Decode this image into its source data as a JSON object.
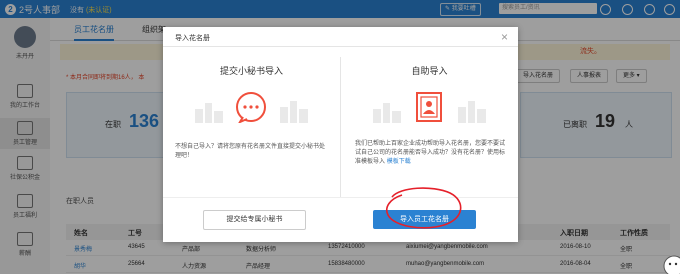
{
  "app": {
    "logo": "2号人事部",
    "company_prefix": "没有",
    "company_status": "(未认证)",
    "header_button": "我要吐槽",
    "search_placeholder": "搜索员工/资讯"
  },
  "sidebar": {
    "items": [
      {
        "label": "未丹丹",
        "icon": "avatar-icon"
      },
      {
        "label": "我的工作台",
        "icon": "monitor-icon"
      },
      {
        "label": "员工管理",
        "icon": "people-icon"
      },
      {
        "label": "社保公积金",
        "icon": "house-icon"
      },
      {
        "label": "员工福利",
        "icon": "gift-icon"
      },
      {
        "label": "薪酬",
        "icon": "wallet-icon"
      }
    ]
  },
  "tabs": [
    {
      "label": "员工花名册",
      "active": true
    },
    {
      "label": "组织架"
    }
  ],
  "notice": {
    "text": "流失。"
  },
  "red_line": {
    "text": "* 本月合同即将到期16人，  本"
  },
  "actions": [
    "导入花名册",
    "人事报表",
    "更多 ▾"
  ],
  "stats": {
    "active_label": "在职",
    "active_count": "136",
    "left_label": "已离职",
    "left_count": "19",
    "left_unit": "人"
  },
  "section_label": "在职人员",
  "table": {
    "headers": [
      "姓名",
      "工号",
      "入职日期",
      "工作性质"
    ],
    "rows": [
      {
        "name": "景秀梅",
        "id": "43645",
        "dept": "产品部",
        "title": "数据分析师",
        "phone": "13572410000",
        "email": "aixiumei@yangbenmobile.com",
        "date": "2016-08-10",
        "type": "全职"
      },
      {
        "name": "胡华",
        "id": "25664",
        "dept": "人力资源",
        "title": "产品经理",
        "phone": "15838480000",
        "email": "muhao@yangbenmobile.com",
        "date": "2016-08-04",
        "type": "全职"
      }
    ]
  },
  "modal": {
    "title": "导入花名册",
    "close": "×",
    "left": {
      "title": "提交小秘书导入",
      "desc": "不想自己导入？请将您原有花名册文件直接提交小秘书处理吧！",
      "button": "提交给专属小秘书",
      "icon": "chat-bubble-icon"
    },
    "right": {
      "title": "自助导入",
      "desc": "我们已帮助上百家企业成功帮助导入花名册，您要不要试试自己公司的花名册能否导入成功？没有花名册？使用标准模板导入",
      "link": "模板下载",
      "button": "导入员工花名册",
      "icon": "contact-card-icon"
    }
  }
}
